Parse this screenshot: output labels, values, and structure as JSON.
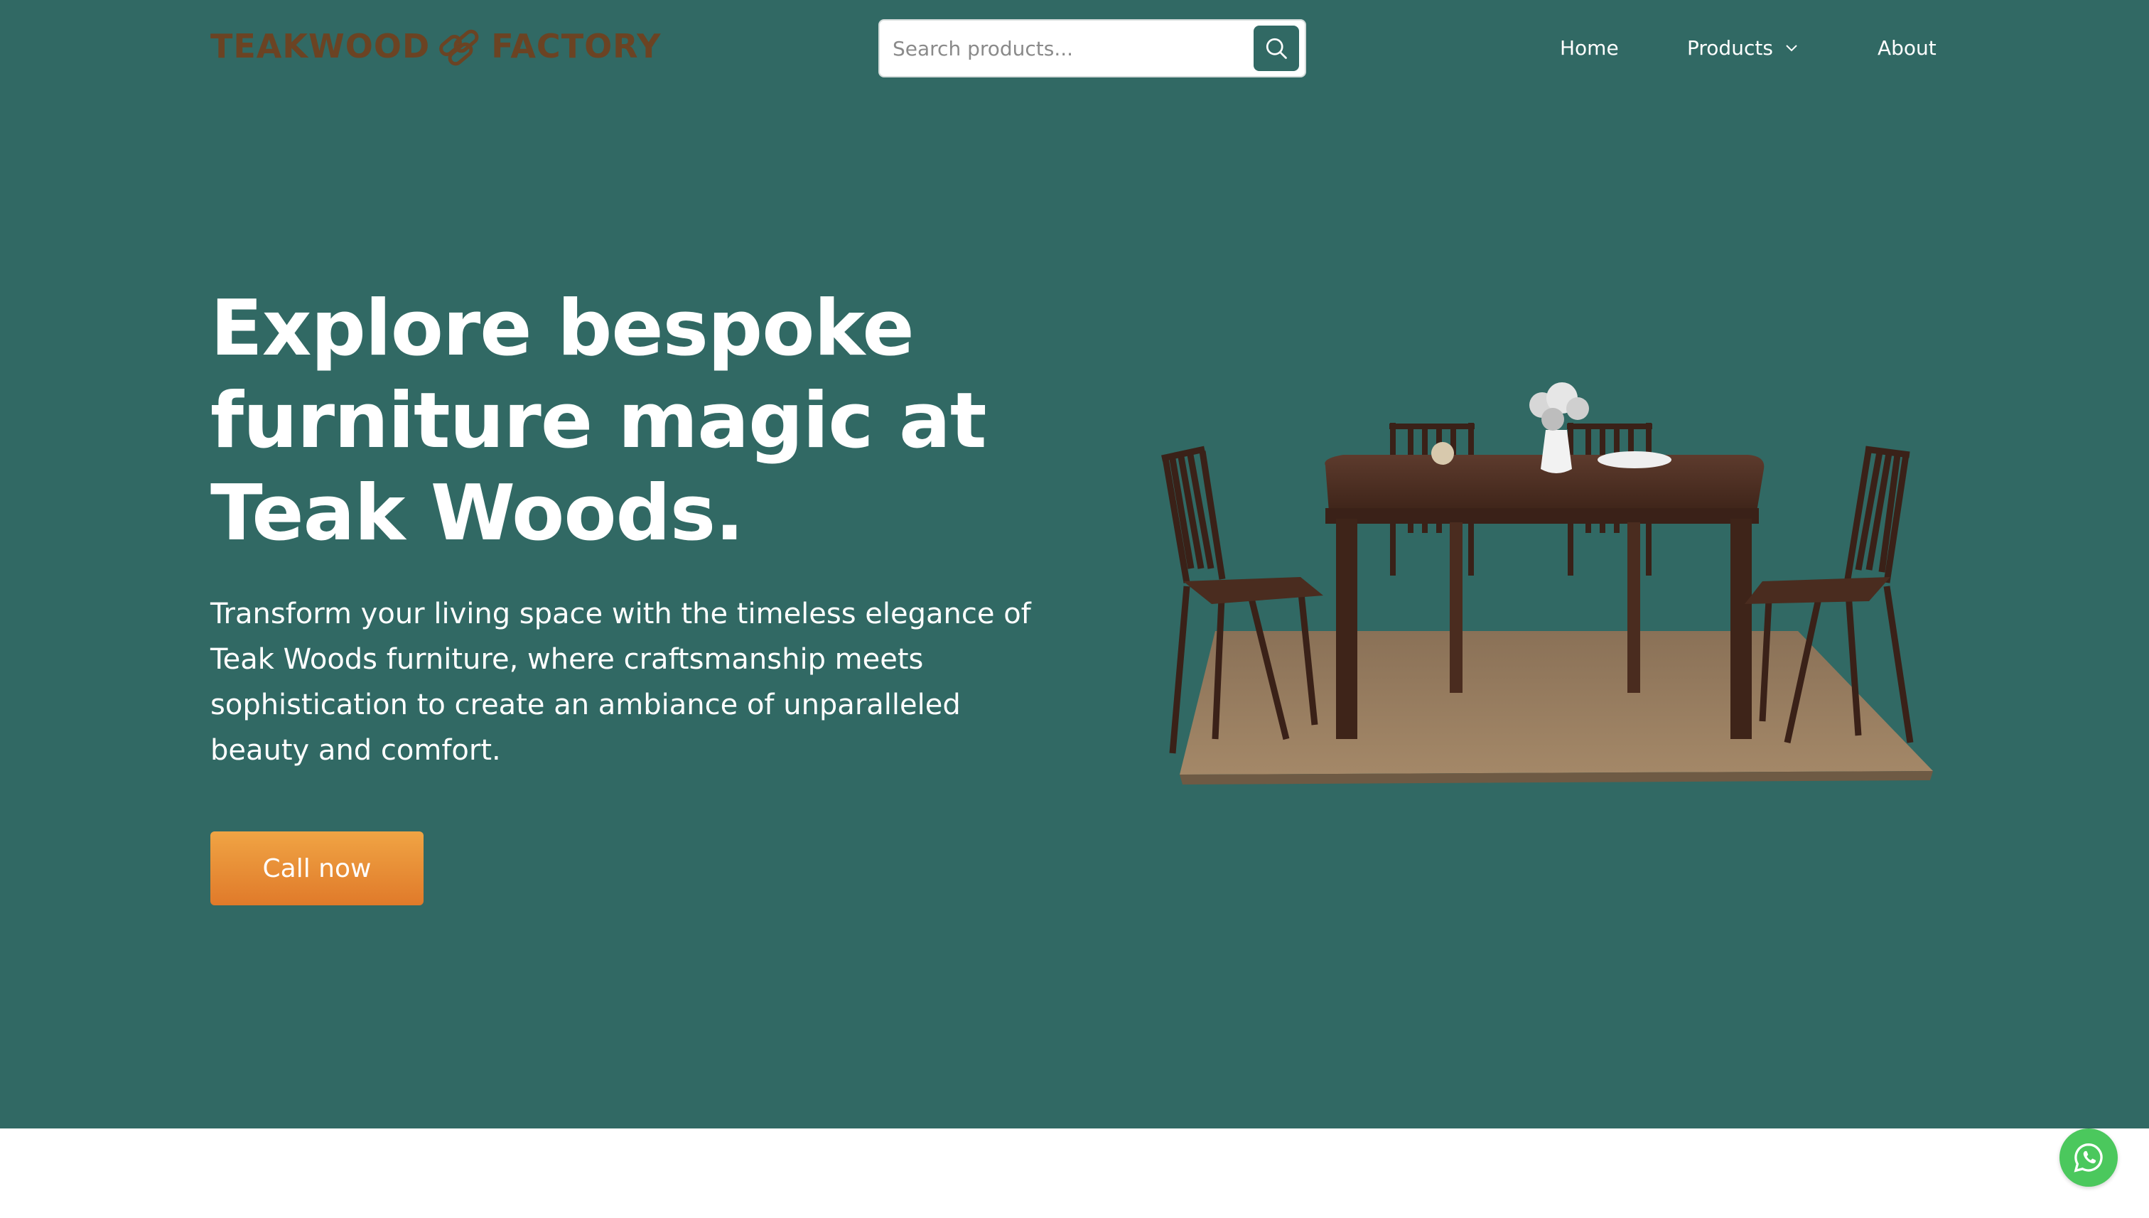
{
  "header": {
    "logo": {
      "word_left": "TEAKWOOD",
      "word_right": "FACTORY",
      "mark_icon": "logs-icon"
    },
    "search": {
      "placeholder": "Search products...",
      "value": "",
      "button_icon": "search-icon"
    },
    "nav": [
      {
        "label": "Home"
      },
      {
        "label": "Products",
        "icon": "chevron-down-icon"
      },
      {
        "label": "About"
      }
    ]
  },
  "hero": {
    "headline": "Explore bespoke furniture magic at Teak Woods.",
    "lede": "Transform your living space with the timeless elegance of Teak Woods furniture, where craftsmanship meets sophistication to create an ambiance of unparalleled beauty and comfort.",
    "cta_label": "Call now",
    "image_icon": "dining-set-image"
  },
  "floating": {
    "whatsapp_icon": "whatsapp-icon"
  },
  "colors": {
    "hero_bg": "#316964",
    "logo_brown": "#6b4323",
    "cta_start": "#f0a444",
    "cta_end": "#e07a2a",
    "whatsapp": "#4bc85d",
    "page_bg": "#ffffff"
  }
}
